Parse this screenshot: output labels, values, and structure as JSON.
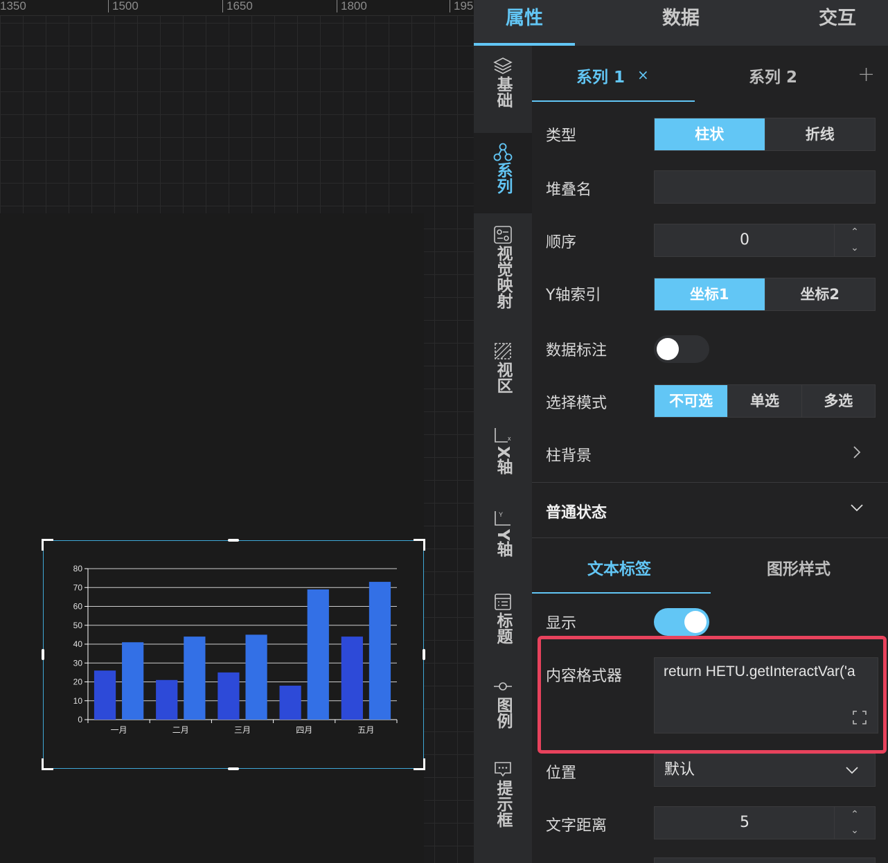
{
  "ruler": {
    "labels": [
      "1350",
      "1500",
      "1650",
      "1800",
      "195"
    ]
  },
  "chart_data": {
    "type": "bar",
    "categories": [
      "一月",
      "二月",
      "三月",
      "四月",
      "五月"
    ],
    "series": [
      {
        "values": [
          26,
          21,
          25,
          18,
          44
        ],
        "color": "#2d4ad8"
      },
      {
        "values": [
          41,
          44,
          45,
          69,
          73
        ],
        "color": "#3370e6"
      }
    ],
    "yticks": [
      "0",
      "10",
      "20",
      "30",
      "40",
      "50",
      "60",
      "70",
      "80"
    ],
    "ylim": [
      0,
      80
    ],
    "grid": true
  },
  "top_tabs": {
    "attributes": "属性",
    "data": "数据",
    "interaction": "交互"
  },
  "side_nav": {
    "basic": "基础",
    "series": "系列",
    "visual_map": "视觉映射",
    "viewport": "视区",
    "x_axis": "X轴",
    "y_axis": "Y轴",
    "title": "标题",
    "legend": "图例",
    "tooltip": "提示框"
  },
  "series_tabs": {
    "tab1": "系列 1",
    "tab2": "系列 2",
    "close": "×",
    "add": "+"
  },
  "form": {
    "type_label": "类型",
    "type_options": [
      "柱状",
      "折线"
    ],
    "stack_label": "堆叠名",
    "stack_value": "",
    "order_label": "顺序",
    "order_value": "0",
    "yaxis_label": "Y轴索引",
    "yaxis_options": [
      "坐标1",
      "坐标2"
    ],
    "data_label_label": "数据标注",
    "select_mode_label": "选择模式",
    "select_mode_options": [
      "不可选",
      "单选",
      "多选"
    ],
    "bar_bg_label": "柱背景",
    "normal_state_label": "普通状态"
  },
  "text_tabs": {
    "text_label": "文本标签",
    "shape_style": "图形样式"
  },
  "text_label": {
    "show_label": "显示",
    "formatter_label": "内容格式器",
    "formatter_code": "return HETU.getInteractVar('a",
    "position_label": "位置",
    "position_value": "默认",
    "distance_label": "文字距离",
    "distance_value": "5"
  },
  "colors": {
    "accent": "#62c6f5",
    "highlight": "#e8425c"
  }
}
